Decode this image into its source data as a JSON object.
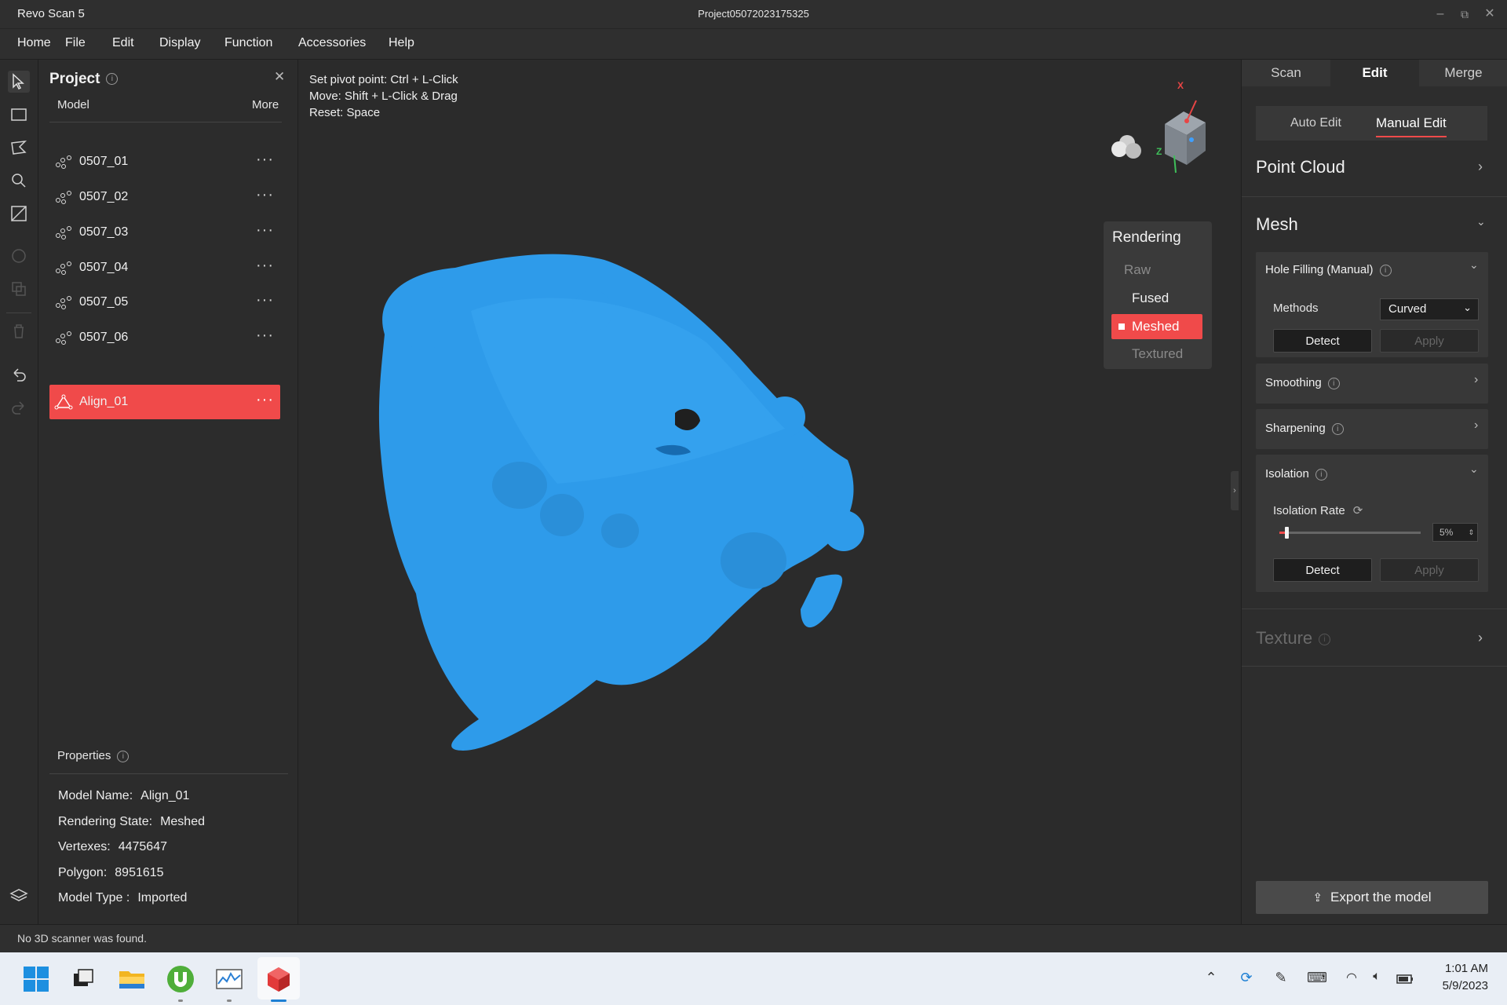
{
  "window": {
    "app_title": "Revo Scan 5",
    "project_title": "Project05072023175325",
    "minimize": "–",
    "restore": "⧉",
    "close": "✕"
  },
  "menu": [
    "Home",
    "File",
    "Edit",
    "Display",
    "Function",
    "Accessories",
    "Help"
  ],
  "project_panel": {
    "title": "Project",
    "info": "i",
    "close": "✕",
    "col_model": "Model",
    "col_more": "More",
    "models": [
      {
        "name": "0507_01",
        "more": "···"
      },
      {
        "name": "0507_02",
        "more": "···"
      },
      {
        "name": "0507_03",
        "more": "···"
      },
      {
        "name": "0507_04",
        "more": "···"
      },
      {
        "name": "0507_05",
        "more": "···"
      },
      {
        "name": "0507_06",
        "more": "···"
      },
      {
        "name": "Align_01",
        "more": "···"
      }
    ],
    "selected_model": "Align_01"
  },
  "properties": {
    "title": "Properties",
    "info": "i",
    "model_name_label": "Model Name:",
    "model_name": "Align_01",
    "rendering_state_label": "Rendering State:",
    "rendering_state": "Meshed",
    "vertexes_label": "Vertexes:",
    "vertexes": "4475647",
    "polygon_label": "Polygon:",
    "polygon": "8951615",
    "model_type_label": "Model Type :",
    "model_type": "Imported"
  },
  "viewport": {
    "hint_pivot": "Set pivot point:  Ctrl + L-Click",
    "hint_move": "Move:  Shift + L-Click & Drag",
    "hint_reset": "Reset:  Space",
    "axis_x": "X",
    "axis_z": "Z",
    "mesh_color": "#2e9bea",
    "collapse": "›"
  },
  "rendering": {
    "title": "Rendering",
    "options": [
      "Raw",
      "Fused",
      "Meshed",
      "Textured"
    ],
    "selected": "Meshed"
  },
  "right_panel": {
    "tabs": [
      "Scan",
      "Edit",
      "Merge"
    ],
    "active_tab": "Edit",
    "subtabs": [
      "Auto Edit",
      "Manual Edit"
    ],
    "active_subtab": "Manual Edit",
    "point_cloud": "Point Cloud",
    "mesh": "Mesh",
    "hole_filling": {
      "title": "Hole Filling (Manual)",
      "info": "i",
      "methods_label": "Methods",
      "method_value": "Curved",
      "detect": "Detect",
      "apply": "Apply"
    },
    "smoothing": {
      "title": "Smoothing",
      "info": "i"
    },
    "sharpening": {
      "title": "Sharpening",
      "info": "i"
    },
    "isolation": {
      "title": "Isolation",
      "info": "i",
      "rate_label": "Isolation Rate",
      "rate_value": "5%",
      "rate_fraction": 0.05,
      "detect": "Detect",
      "apply": "Apply"
    },
    "texture": {
      "title": "Texture",
      "info": "i"
    },
    "export": "Export the model"
  },
  "status": {
    "text": "No 3D scanner was found."
  },
  "taskbar": {
    "time": "1:01 AM",
    "date": "5/9/2023"
  },
  "colors": {
    "accent": "#f04a4a",
    "mesh": "#2e9bea",
    "background": "#2b2b2b"
  }
}
